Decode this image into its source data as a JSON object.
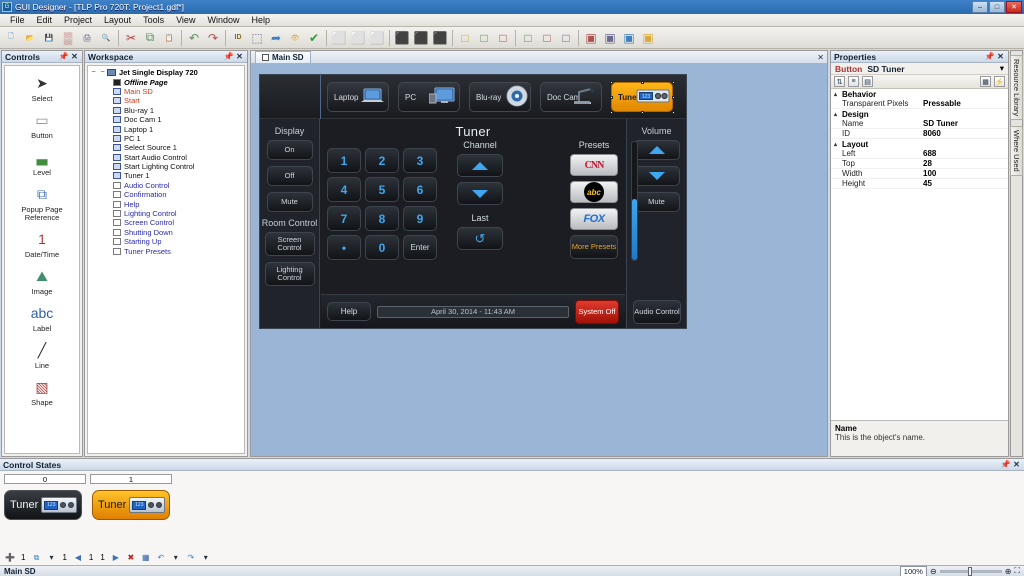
{
  "window": {
    "title": "GUI Designer - [TLP Pro 720T: Project1.gdf*]",
    "minimize": "–",
    "maximize": "□",
    "close": "✕",
    "app_icon": "G"
  },
  "menu": {
    "items": [
      "File",
      "Edit",
      "Project",
      "Layout",
      "Tools",
      "View",
      "Window",
      "Help"
    ]
  },
  "toolbar": {
    "groups": [
      {
        "items": [
          {
            "name": "new-file-icon",
            "glyph": "🗋"
          },
          {
            "name": "open-folder-icon",
            "glyph": "📂"
          },
          {
            "name": "save-icon",
            "glyph": "💾"
          },
          {
            "name": "color-matrix-icon",
            "glyph": "▒"
          },
          {
            "name": "print-icon",
            "glyph": "🖨"
          },
          {
            "name": "print-preview-icon",
            "glyph": "🔍"
          }
        ]
      },
      {
        "items": [
          {
            "name": "cut-icon",
            "glyph": "✂"
          },
          {
            "name": "copy-icon",
            "glyph": "⧉"
          },
          {
            "name": "paste-icon",
            "glyph": "📋"
          }
        ]
      },
      {
        "items": [
          {
            "name": "undo-icon",
            "glyph": "↶"
          },
          {
            "name": "redo-icon",
            "glyph": "↷"
          }
        ]
      },
      {
        "items": [
          {
            "name": "object-id-icon",
            "glyph": "ID"
          },
          {
            "name": "page-properties-icon",
            "glyph": "⬚"
          },
          {
            "name": "export-icon",
            "glyph": "➦"
          },
          {
            "name": "preview-eye-icon",
            "glyph": "👁"
          },
          {
            "name": "validate-check-icon",
            "glyph": "✔"
          }
        ]
      },
      {
        "items": [
          {
            "name": "align-left-icon",
            "glyph": "⬜"
          },
          {
            "name": "align-center-h-icon",
            "glyph": "⬜"
          },
          {
            "name": "align-right-icon",
            "glyph": "⬜"
          }
        ]
      },
      {
        "items": [
          {
            "name": "align-top-icon",
            "glyph": "⬛"
          },
          {
            "name": "align-middle-v-icon",
            "glyph": "⬛"
          },
          {
            "name": "align-bottom-icon",
            "glyph": "⬛"
          }
        ]
      },
      {
        "items": [
          {
            "name": "same-width-icon",
            "glyph": "□"
          },
          {
            "name": "same-height-icon",
            "glyph": "□"
          },
          {
            "name": "same-size-icon",
            "glyph": "□"
          }
        ]
      },
      {
        "items": [
          {
            "name": "distribute-h-icon",
            "glyph": "□"
          },
          {
            "name": "distribute-v-icon",
            "glyph": "□"
          },
          {
            "name": "center-page-icon",
            "glyph": "□"
          }
        ]
      },
      {
        "items": [
          {
            "name": "state-equal-icon",
            "glyph": "▣"
          },
          {
            "name": "state-add-icon",
            "glyph": "▣"
          },
          {
            "name": "state-remove-icon",
            "glyph": "▣"
          },
          {
            "name": "state-multiply-icon",
            "glyph": "▣"
          }
        ]
      }
    ]
  },
  "controls_panel": {
    "title": "Controls",
    "pin_icon": "📌",
    "close_icon": "✕",
    "items": [
      {
        "label": "Select",
        "icon": "cursor-arrow-icon",
        "glyph": "➤"
      },
      {
        "label": "Button",
        "icon": "button-icon",
        "glyph": "▭"
      },
      {
        "label": "Level",
        "icon": "level-bars-icon",
        "glyph": "▃"
      },
      {
        "label": "Popup Page Reference",
        "icon": "popup-pages-icon",
        "glyph": "⧉"
      },
      {
        "label": "Date/Time",
        "icon": "calendar-icon",
        "glyph": "1"
      },
      {
        "label": "Image",
        "icon": "image-icon",
        "glyph": "⛰"
      },
      {
        "label": "Label",
        "icon": "label-icon",
        "glyph": "abc"
      },
      {
        "label": "Line",
        "icon": "line-icon",
        "glyph": "╱"
      },
      {
        "label": "Shape",
        "icon": "shape-icon",
        "glyph": "▧"
      }
    ]
  },
  "workspace_panel": {
    "title": "Workspace",
    "pin_icon": "📌",
    "close_icon": "✕",
    "root": {
      "label": "Jet Single Display 720",
      "expander": "−"
    },
    "nodes": [
      {
        "label": "Offline Page",
        "style": "italic-bold",
        "color": "#000000"
      },
      {
        "label": "Main SD",
        "style": "normal",
        "color": "#d03a1c"
      },
      {
        "label": "Start",
        "style": "normal",
        "color": "#d03a1c"
      },
      {
        "label": "Blu-ray 1",
        "style": "normal",
        "color": "#111111"
      },
      {
        "label": "Doc Cam 1",
        "style": "normal",
        "color": "#111111"
      },
      {
        "label": "Laptop 1",
        "style": "normal",
        "color": "#111111"
      },
      {
        "label": "PC 1",
        "style": "normal",
        "color": "#111111"
      },
      {
        "label": "Select Source 1",
        "style": "normal",
        "color": "#111111"
      },
      {
        "label": "Start Audio Control",
        "style": "normal",
        "color": "#111111"
      },
      {
        "label": "Start Lighting Control",
        "style": "normal",
        "color": "#111111"
      },
      {
        "label": "Tuner 1",
        "style": "normal",
        "color": "#111111"
      },
      {
        "label": "Audio Control",
        "style": "normal",
        "color": "#2a2ab0"
      },
      {
        "label": "Confirmation",
        "style": "normal",
        "color": "#2a2ab0"
      },
      {
        "label": "Help",
        "style": "normal",
        "color": "#2a2ab0"
      },
      {
        "label": "Lighting Control",
        "style": "normal",
        "color": "#2a2ab0"
      },
      {
        "label": "Screen Control",
        "style": "normal",
        "color": "#2a2ab0"
      },
      {
        "label": "Shutting Down",
        "style": "normal",
        "color": "#2a2ab0"
      },
      {
        "label": "Starting Up",
        "style": "normal",
        "color": "#2a2ab0"
      },
      {
        "label": "Tuner Presets",
        "style": "normal",
        "color": "#2a2ab0"
      }
    ]
  },
  "canvas": {
    "tab_label": "Main SD",
    "tab_close_icon": "✕",
    "touchpanel": {
      "sources": [
        {
          "label": "Laptop",
          "icon": "laptop-icon",
          "selected": false
        },
        {
          "label": "PC",
          "icon": "desktop-pc-icon",
          "selected": false
        },
        {
          "label": "Blu-ray",
          "icon": "disc-icon",
          "selected": false
        },
        {
          "label": "Doc Cam",
          "icon": "document-camera-icon",
          "selected": false
        },
        {
          "label": "Tuner",
          "icon": "tuner-device-icon",
          "selected": true
        }
      ],
      "left_column": {
        "display_title": "Display",
        "display_buttons": [
          "On",
          "Off",
          "Mute"
        ],
        "room_title": "Room Control",
        "room_buttons": [
          "Screen Control",
          "Lighting Control"
        ]
      },
      "center": {
        "title": "Tuner",
        "keypad": [
          "1",
          "2",
          "3",
          "4",
          "5",
          "6",
          "7",
          "8",
          "9",
          "•",
          "0",
          "Enter"
        ],
        "channel_label": "Channel",
        "channel_up_icon": "triangle-up-icon",
        "channel_down_icon": "triangle-down-icon",
        "last_label": "Last",
        "last_icon": "recall-arrow-icon",
        "presets_label": "Presets",
        "presets": [
          "CNN",
          "abc",
          "FOX"
        ],
        "more_presets": "More Presets"
      },
      "right_column": {
        "volume_title": "Volume",
        "volume_up_icon": "triangle-up-icon",
        "volume_down_icon": "triangle-down-icon",
        "mute_label": "Mute",
        "audio_control_label": "Audio Control",
        "level_percent": 52
      },
      "bottom_bar": {
        "help_label": "Help",
        "datetime": "April 30, 2014  -  11:43 AM",
        "system_off_label": "System Off"
      }
    }
  },
  "properties_panel": {
    "title": "Properties",
    "pin_icon": "📌",
    "close_icon": "✕",
    "object_type": "Button",
    "object_name": "SD Tuner",
    "dropdown_icon": "▾",
    "tools": [
      {
        "name": "sort-az-icon",
        "glyph": "⇅"
      },
      {
        "name": "categorized-icon",
        "glyph": "≡"
      },
      {
        "name": "alphabetical-icon",
        "glyph": "▤"
      },
      {
        "name": "properties-view-icon",
        "glyph": "▦"
      },
      {
        "name": "events-view-icon",
        "glyph": "⚡"
      }
    ],
    "categories": [
      {
        "name": "Behavior",
        "arrow": "▴",
        "rows": [
          {
            "name": "Transparent Pixels",
            "value": "Pressable"
          }
        ]
      },
      {
        "name": "Design",
        "arrow": "▴",
        "rows": [
          {
            "name": "Name",
            "value": "SD Tuner"
          },
          {
            "name": "ID",
            "value": "8060"
          }
        ]
      },
      {
        "name": "Layout",
        "arrow": "▴",
        "rows": [
          {
            "name": "Left",
            "value": "688"
          },
          {
            "name": "Top",
            "value": "28"
          },
          {
            "name": "Width",
            "value": "100"
          },
          {
            "name": "Height",
            "value": "45"
          }
        ]
      }
    ],
    "description": {
      "title": "Name",
      "text": "This is the object's name."
    }
  },
  "right_tabs": [
    {
      "label": "Resource Library",
      "icon": "library-icon"
    },
    {
      "label": "Where Used",
      "icon": "where-used-icon"
    }
  ],
  "control_states": {
    "title": "Control States",
    "pin_icon": "📌",
    "close_icon": "✕",
    "state_numbers": [
      "0",
      "1"
    ],
    "states": [
      {
        "index": "0",
        "label": "Tuner",
        "variant": "off"
      },
      {
        "index": "1",
        "label": "Tuner",
        "variant": "on"
      }
    ],
    "device_screen_text": "123",
    "toolbar": {
      "new_state_icon": "add-state-icon",
      "new_state_count": "1",
      "copy_state_icon": "copy-state-icon",
      "copy_state_count": "1",
      "prev_icon": "◀",
      "prev_count": "1",
      "current_count": "1",
      "next_icon": "▶",
      "delete_icon": "✖",
      "grid_icon": "▦",
      "undo_icon": "↶",
      "redo_icon": "↷",
      "dropdown_icon": "▾"
    }
  },
  "statusbar": {
    "page_name": "Main SD",
    "zoom_level": "100%",
    "zoom_out_icon": "⊖",
    "zoom_in_icon": "⊕",
    "fit_icon": "⛶"
  }
}
